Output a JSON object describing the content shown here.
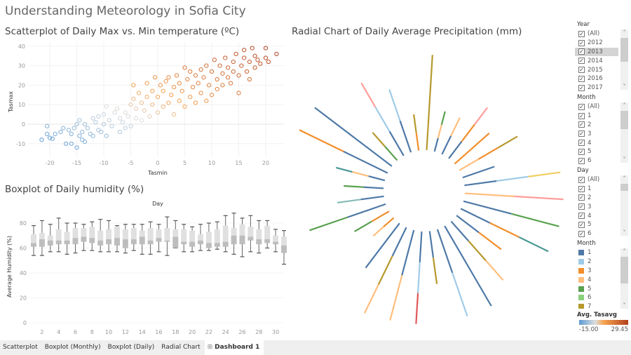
{
  "title": "Understanding Meteorology in Sofia City",
  "scatter": {
    "title": "Scatterplot of Daily Max vs. Min temperature (ºC)"
  },
  "boxplot": {
    "title": "Boxplot of Daily humidity (%)"
  },
  "radial": {
    "title": "Radial Chart of Daily Average Precipitation (mm)"
  },
  "colors": {
    "month": {
      "1": "#4e79a7",
      "2": "#a0cbe8",
      "3": "#f28e2b",
      "4": "#ffbe7d",
      "5": "#59a14f",
      "6": "#8cd17d",
      "7": "#b6992d",
      "8": "#f1ce63",
      "9": "#499894",
      "10": "#86bcb6",
      "11": "#e15759",
      "12": "#ff9d9a"
    },
    "tasavg_low": "#5b9bd5",
    "tasavg_mid": "#dddddd",
    "tasavg_high2": "#f7a450",
    "tasavg_high": "#b1401d"
  },
  "chart_data": [
    {
      "type": "scatter",
      "title": "Scatterplot of Daily Max vs. Min temperature (ºC)",
      "xlabel": "Tasmin",
      "ylabel": "Tasmax",
      "xlim": [
        -23,
        23
      ],
      "ylim": [
        -15,
        42
      ],
      "xticks": [
        -20,
        -15,
        -10,
        -5,
        0,
        5,
        10,
        15,
        20
      ],
      "yticks": [
        -10,
        0,
        10,
        20,
        30,
        40
      ],
      "grid": true,
      "color_by": "Avg. Tasavg",
      "points": [
        [
          -21.5,
          -8
        ],
        [
          -20.5,
          -1
        ],
        [
          -20.5,
          -5
        ],
        [
          -20,
          -7
        ],
        [
          -19.5,
          -7.5
        ],
        [
          -19,
          -5
        ],
        [
          -18,
          -4
        ],
        [
          -17.5,
          -2
        ],
        [
          -17,
          -10
        ],
        [
          -16.5,
          -3
        ],
        [
          -16,
          -5
        ],
        [
          -16,
          -10
        ],
        [
          -15.5,
          -2
        ],
        [
          -15,
          0
        ],
        [
          -15,
          -12
        ],
        [
          -14.5,
          2
        ],
        [
          -14.5,
          -6
        ],
        [
          -14,
          -4
        ],
        [
          -14,
          -8
        ],
        [
          -13.5,
          0
        ],
        [
          -13.5,
          -9
        ],
        [
          -13,
          -2
        ],
        [
          -12.5,
          -5
        ],
        [
          -12,
          3
        ],
        [
          -12,
          -6
        ],
        [
          -11.5,
          1
        ],
        [
          -11,
          -3
        ],
        [
          -11,
          4
        ],
        [
          -10.5,
          -4
        ],
        [
          -10,
          0
        ],
        [
          -10,
          5
        ],
        [
          -9.5,
          -6
        ],
        [
          -9.5,
          9
        ],
        [
          -9,
          2
        ],
        [
          -8.5,
          -1
        ],
        [
          -8,
          6
        ],
        [
          -7.5,
          8
        ],
        [
          -7,
          -4
        ],
        [
          -7,
          3
        ],
        [
          -6.5,
          1
        ],
        [
          -6,
          -2
        ],
        [
          -6,
          6
        ],
        [
          -5.5,
          4
        ],
        [
          -5,
          -1
        ],
        [
          -5,
          10
        ],
        [
          -4.5,
          20
        ],
        [
          -4.5,
          13
        ],
        [
          -4,
          3
        ],
        [
          -4,
          8
        ],
        [
          -3.5,
          16
        ],
        [
          -3,
          2
        ],
        [
          -3,
          11
        ],
        [
          -2.5,
          7
        ],
        [
          -2,
          14
        ],
        [
          -2,
          21
        ],
        [
          -1.5,
          4
        ],
        [
          -1,
          10
        ],
        [
          -1,
          17
        ],
        [
          -0.5,
          24
        ],
        [
          0,
          6
        ],
        [
          0,
          14
        ],
        [
          0.5,
          20
        ],
        [
          1,
          9
        ],
        [
          1,
          17
        ],
        [
          1.5,
          22
        ],
        [
          2,
          11
        ],
        [
          2,
          24
        ],
        [
          2.5,
          15
        ],
        [
          3,
          5
        ],
        [
          3,
          19
        ],
        [
          3.5,
          25
        ],
        [
          4,
          12
        ],
        [
          4,
          21
        ],
        [
          4.5,
          17
        ],
        [
          5,
          29
        ],
        [
          5,
          9
        ],
        [
          5.5,
          23
        ],
        [
          6,
          14
        ],
        [
          6,
          27
        ],
        [
          6.5,
          19
        ],
        [
          7,
          25
        ],
        [
          7,
          11
        ],
        [
          7.5,
          21
        ],
        [
          8,
          28
        ],
        [
          8,
          16
        ],
        [
          8.5,
          24
        ],
        [
          9,
          12
        ],
        [
          9,
          30
        ],
        [
          9.5,
          20
        ],
        [
          10,
          27
        ],
        [
          10,
          15
        ],
        [
          10.5,
          33
        ],
        [
          11,
          23
        ],
        [
          11,
          18
        ],
        [
          11.5,
          30
        ],
        [
          12,
          26
        ],
        [
          12,
          20
        ],
        [
          12.5,
          34
        ],
        [
          13,
          24
        ],
        [
          13,
          29
        ],
        [
          13.5,
          21
        ],
        [
          14,
          32
        ],
        [
          14,
          27
        ],
        [
          14.5,
          36
        ],
        [
          15,
          25
        ],
        [
          15,
          16
        ],
        [
          15.5,
          30
        ],
        [
          16,
          38
        ],
        [
          16,
          34
        ],
        [
          16.5,
          27
        ],
        [
          17,
          32
        ],
        [
          17,
          23
        ],
        [
          17.5,
          39
        ],
        [
          18,
          29
        ],
        [
          18,
          35
        ],
        [
          18.5,
          33
        ],
        [
          19,
          31
        ],
        [
          20,
          39
        ],
        [
          20,
          34
        ],
        [
          20.5,
          32
        ],
        [
          22,
          36
        ]
      ]
    },
    {
      "type": "box",
      "title": "Boxplot of Daily humidity (%)",
      "xlabel": "Day",
      "ylabel": "Average Humidity (%)",
      "ylim": [
        0,
        90
      ],
      "yticks": [
        0,
        20,
        40,
        60,
        80
      ],
      "xticks": [
        2,
        4,
        6,
        8,
        10,
        12,
        14,
        16,
        18,
        20,
        22,
        24,
        26,
        28,
        30
      ],
      "fields": [
        "min",
        "q1",
        "median",
        "q3",
        "max"
      ],
      "boxes": [
        [
          54,
          61,
          64,
          71,
          78
        ],
        [
          54,
          61,
          67,
          72,
          82
        ],
        [
          57,
          62,
          66,
          70,
          79
        ],
        [
          57,
          63,
          66,
          75,
          84
        ],
        [
          55,
          63,
          66,
          73,
          80
        ],
        [
          56,
          63,
          68,
          76,
          80
        ],
        [
          58,
          65,
          69,
          76,
          79
        ],
        [
          58,
          64,
          68,
          77,
          81
        ],
        [
          57,
          62,
          66,
          74,
          83
        ],
        [
          57,
          63,
          67,
          75,
          82
        ],
        [
          57,
          62,
          68,
          77,
          78
        ],
        [
          56,
          60,
          67,
          75,
          79
        ],
        [
          58,
          63,
          67,
          76,
          79
        ],
        [
          55,
          63,
          69,
          74,
          79
        ],
        [
          55,
          63,
          66,
          76,
          81
        ],
        [
          57,
          65,
          68,
          75,
          79
        ],
        [
          54,
          65,
          66,
          76,
          85
        ],
        [
          60,
          60,
          69,
          75,
          82
        ],
        [
          57,
          63,
          65,
          75,
          79
        ],
        [
          57,
          61,
          65,
          74,
          77
        ],
        [
          58,
          63,
          66,
          71,
          79
        ],
        [
          58,
          60,
          64,
          73,
          80
        ],
        [
          59,
          61,
          64,
          75,
          81
        ],
        [
          57,
          61,
          65,
          78,
          86
        ],
        [
          55,
          63,
          70,
          76,
          88
        ],
        [
          53,
          63,
          70,
          79,
          84
        ],
        [
          57,
          66,
          69,
          77,
          86
        ],
        [
          56,
          63,
          67,
          75,
          82
        ],
        [
          60,
          64,
          67,
          78,
          82
        ],
        [
          57,
          63,
          65,
          70,
          75
        ],
        [
          47,
          56,
          62,
          69,
          74
        ]
      ]
    },
    {
      "type": "radial",
      "title": "Radial Chart of Daily Average Precipitation (mm)",
      "color_by": "Month",
      "spokes": [
        {
          "value": 13.6,
          "months": [
            7
          ]
        },
        {
          "value": 5.9,
          "months": [
            1,
            4,
            5
          ]
        },
        {
          "value": 5.8,
          "months": [
            1,
            4
          ]
        },
        {
          "value": 9.1,
          "months": [
            1,
            3,
            12
          ]
        },
        {
          "value": 6.6,
          "months": [
            3
          ]
        },
        {
          "value": 9.6,
          "months": [
            4,
            3,
            7
          ]
        },
        {
          "value": 4.8,
          "months": [
            1
          ]
        },
        {
          "value": 13.8,
          "months": [
            1,
            2,
            8
          ]
        },
        {
          "value": 14.1,
          "months": [
            4,
            12
          ]
        },
        {
          "value": 14.1,
          "months": [
            1,
            5
          ]
        },
        {
          "value": 13.9,
          "months": [
            1,
            3,
            9
          ]
        },
        {
          "value": 8.0,
          "months": [
            1,
            3
          ]
        },
        {
          "value": 11.2,
          "months": [
            1,
            7,
            4
          ]
        },
        {
          "value": 13.2,
          "months": [
            1
          ]
        },
        {
          "value": 13.1,
          "months": [
            1,
            2
          ]
        },
        {
          "value": 7.6,
          "months": [
            1,
            7
          ]
        },
        {
          "value": 13.2,
          "months": [
            1,
            2,
            11
          ]
        },
        {
          "value": 13.3,
          "months": [
            1,
            4
          ]
        },
        {
          "value": 13.6,
          "months": [
            1,
            7,
            4
          ]
        },
        {
          "value": 8.0,
          "months": [
            1
          ]
        },
        {
          "value": 3.9,
          "months": [
            3,
            4
          ]
        },
        {
          "value": 5.7,
          "months": [
            3,
            5
          ]
        },
        {
          "value": 11.5,
          "months": [
            1,
            5
          ]
        },
        {
          "value": 6.7,
          "months": [
            1,
            10
          ]
        },
        {
          "value": 5.7,
          "months": [
            1,
            5
          ]
        },
        {
          "value": 7.2,
          "months": [
            1,
            4,
            9
          ]
        },
        {
          "value": 14.0,
          "months": [
            1,
            3
          ]
        },
        {
          "value": 13.8,
          "months": [
            1
          ]
        },
        {
          "value": 5.3,
          "months": [
            5,
            7
          ]
        },
        {
          "value": 12.0,
          "months": [
            1,
            2,
            12
          ]
        },
        {
          "value": 9.5,
          "months": [
            1,
            2
          ]
        },
        {
          "value": 5.2,
          "months": [
            3,
            7
          ]
        }
      ]
    }
  ],
  "filters": {
    "year": {
      "label": "Year",
      "items": [
        "(All)",
        "2012",
        "2013",
        "2014",
        "2015",
        "2016",
        "2017"
      ],
      "selected": "2013"
    },
    "month": {
      "label": "Month",
      "items": [
        "(All)",
        "1",
        "2",
        "3",
        "4",
        "5",
        "6"
      ]
    },
    "day": {
      "label": "Day",
      "items": [
        "(All)",
        "1",
        "2",
        "3",
        "4",
        "5",
        "6"
      ]
    }
  },
  "legend_month": {
    "label": "Month",
    "items": [
      "1",
      "2",
      "3",
      "4",
      "5",
      "6",
      "7"
    ]
  },
  "legend_tasavg": {
    "label": "Avg. Tasavg",
    "min": "-15.00",
    "max": "29.45"
  },
  "tabs": [
    {
      "label": "Scatterplot"
    },
    {
      "label": "Boxplot (Monthly)"
    },
    {
      "label": "Boxplot (Daily)"
    },
    {
      "label": "Radial Chart"
    },
    {
      "label": "Dashboard 1",
      "active": true,
      "icon": "dashboard-icon"
    }
  ]
}
